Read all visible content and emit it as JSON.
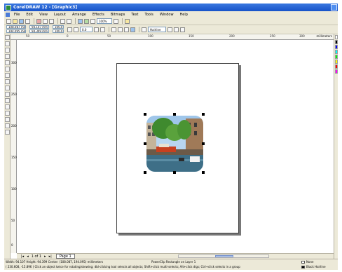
{
  "window": {
    "title": "CorelDRAW 12 - [Graphic3]"
  },
  "menu": [
    "File",
    "Edit",
    "View",
    "Layout",
    "Arrange",
    "Effects",
    "Bitmaps",
    "Text",
    "Tools",
    "Window",
    "Help"
  ],
  "toolbar": {
    "zoom": "100%",
    "x": "108.087 mm",
    "y": "194.095 mm",
    "w": "94.107 mm",
    "h": "94.399 mm",
    "scale_x": "100.0",
    "scale_y": "100.0",
    "angle": "0.0",
    "outline": "Hairline"
  },
  "ruler": {
    "h_ticks": [
      "50",
      "0",
      "50",
      "100",
      "150",
      "200",
      "250",
      "300",
      "350"
    ],
    "h_units": "millimeters",
    "v_ticks": [
      "300",
      "250",
      "200",
      "150",
      "100",
      "50",
      "0"
    ]
  },
  "page_nav": {
    "position": "1 of 1",
    "tab": "Page 1"
  },
  "status": {
    "line1": "Width: 94.107  Height: 94.399  Center: (108.087, 194.095)  millimeters",
    "layer": "PowerClip Rectangle on Layer 1",
    "line2": "( 230.608, -15.896 )    Click an object twice for rotating/skewing; dbl-clicking tool selects all objects; Shift+click multi-selects; Alt+click digs; Ctrl+click selects in a group",
    "fill": "None",
    "outline": "Black  Hairline"
  },
  "icons": {
    "app": "coreldraw-icon",
    "window_buttons": [
      "minimize-icon",
      "maximize-icon",
      "close-icon"
    ]
  },
  "colors": {
    "titlebar": "#1652c8",
    "chrome": "#ece9d8"
  }
}
